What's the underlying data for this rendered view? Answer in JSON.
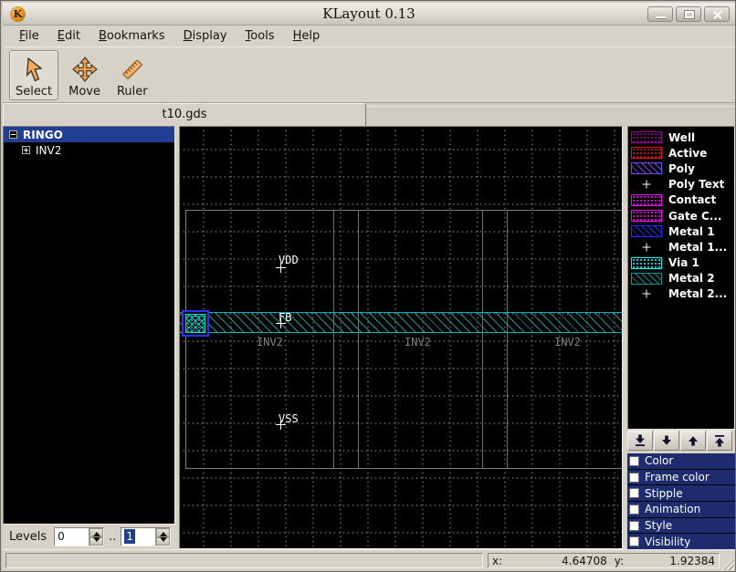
{
  "window": {
    "title": "KLayout 0.13",
    "logo_glyph": "K",
    "controls": [
      "minimize",
      "maximize",
      "close"
    ]
  },
  "menu": {
    "items": [
      {
        "label": "File"
      },
      {
        "label": "Edit"
      },
      {
        "label": "Bookmarks"
      },
      {
        "label": "Display"
      },
      {
        "label": "Tools"
      },
      {
        "label": "Help"
      }
    ]
  },
  "toolbar": {
    "tools": [
      {
        "label": "Select",
        "icon": "cursor-arrow-icon",
        "active": true
      },
      {
        "label": "Move",
        "icon": "move-arrows-icon",
        "active": false
      },
      {
        "label": "Ruler",
        "icon": "ruler-icon",
        "active": false
      }
    ]
  },
  "tabs": {
    "items": [
      {
        "label": "t10.gds",
        "active": true
      }
    ]
  },
  "cell_tree": {
    "items": [
      {
        "label": "RINGO",
        "expanded": true,
        "selected": true
      },
      {
        "label": "INV2",
        "expanded": false,
        "selected": false
      }
    ]
  },
  "levels": {
    "label": "Levels",
    "from": "0",
    "separator": "..",
    "to": "1"
  },
  "canvas": {
    "pins": [
      {
        "label": "VDD"
      },
      {
        "label": "FB"
      },
      {
        "label": "VSS"
      }
    ],
    "instances": [
      {
        "label": "INV2"
      },
      {
        "label": "INV2"
      },
      {
        "label": "INV2"
      }
    ],
    "colors": {
      "metal2_border": "#00b2b2",
      "metal2_hatch": "#1e9494",
      "selection_blue": "#2334ff",
      "via_cyan": "#00e0e0",
      "cell_outline": "#7d7d7d",
      "instance_text": "#7d7d7d"
    }
  },
  "layers": {
    "items": [
      {
        "name": "Well",
        "pattern": "dots",
        "color": "#9c009c"
      },
      {
        "name": "Active",
        "pattern": "dots",
        "color": "#f01010"
      },
      {
        "name": "Poly",
        "pattern": "hatch",
        "color": "#7d46ff"
      },
      {
        "name": "Poly Text",
        "pattern": "plus",
        "color": "#ffffff"
      },
      {
        "name": "Contact",
        "pattern": "dots",
        "color": "#ff00ff"
      },
      {
        "name": "Gate C...",
        "pattern": "dots",
        "color": "#ff00ff"
      },
      {
        "name": "Metal 1",
        "pattern": "hatch",
        "color": "#2828ff"
      },
      {
        "name": "Metal 1...",
        "pattern": "plus",
        "color": "#ffffff"
      },
      {
        "name": "Via 1",
        "pattern": "dots",
        "color": "#00ffff"
      },
      {
        "name": "Metal 2",
        "pattern": "hatch",
        "color": "#009890"
      },
      {
        "name": "Metal 2...",
        "pattern": "plus",
        "color": "#ffffff"
      }
    ]
  },
  "layer_toolbar": {
    "buttons": [
      "move-to-bottom",
      "move-down",
      "move-up",
      "move-to-top"
    ]
  },
  "layer_groups": {
    "items": [
      {
        "label": "Color"
      },
      {
        "label": "Frame color"
      },
      {
        "label": "Stipple"
      },
      {
        "label": "Animation"
      },
      {
        "label": "Style"
      },
      {
        "label": "Visibility"
      }
    ]
  },
  "status": {
    "x_label": "x:",
    "x_value": "4.64708",
    "y_label": "y:",
    "y_value": "1.92384"
  }
}
